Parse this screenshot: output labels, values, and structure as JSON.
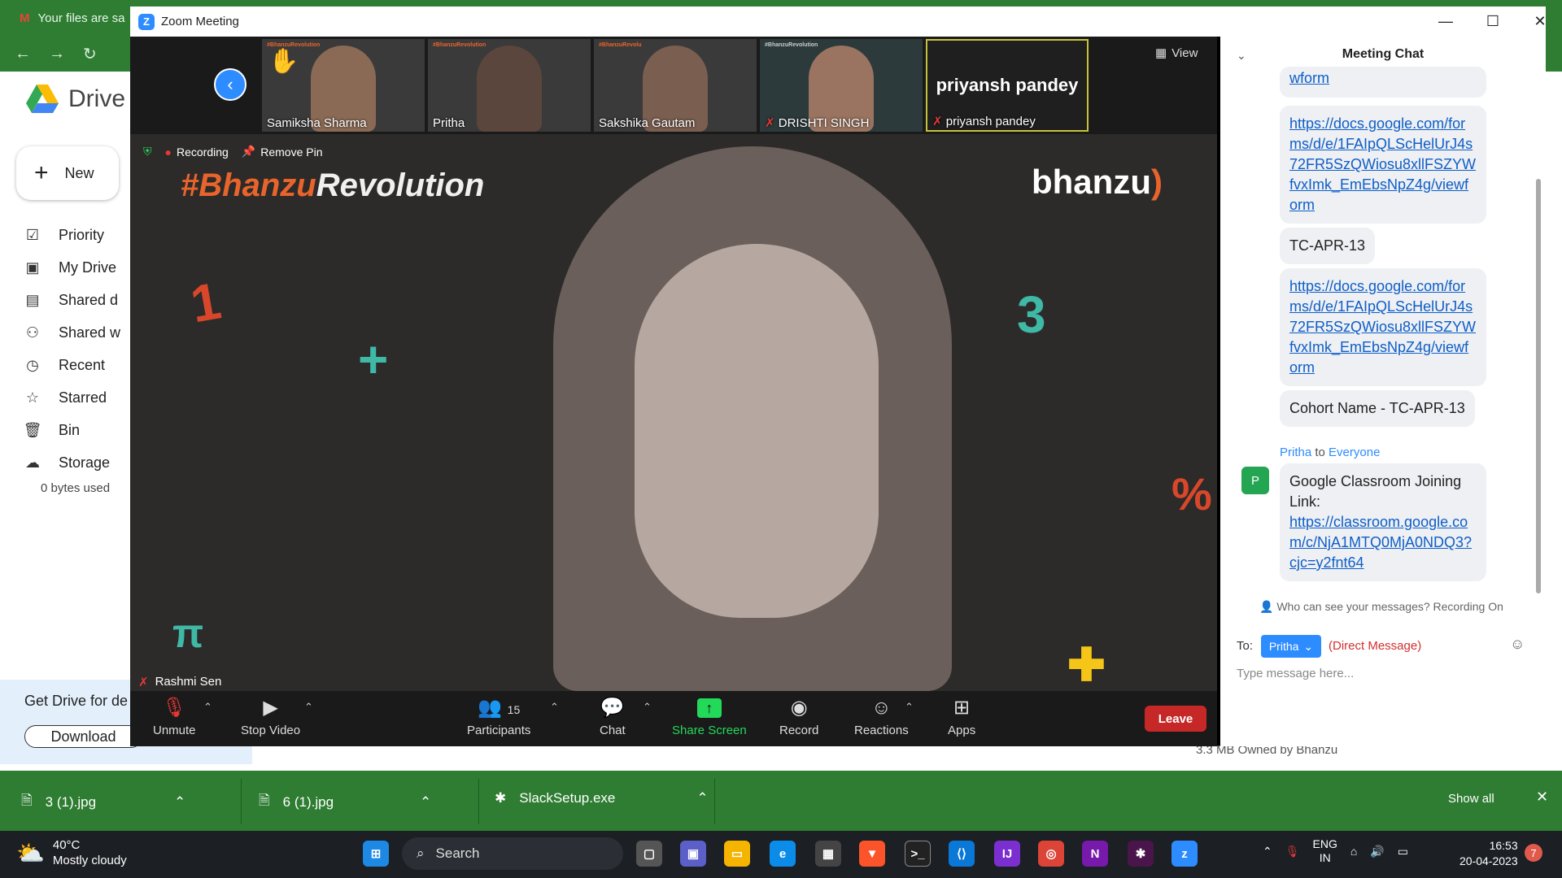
{
  "browser": {
    "tab_title": "Your files are sa"
  },
  "drive": {
    "title": "Drive",
    "new_label": "New",
    "nav": [
      {
        "label": "Priority",
        "icon": "priority-icon"
      },
      {
        "label": "My Drive",
        "icon": "my-drive-icon"
      },
      {
        "label": "Shared d",
        "icon": "shared-drives-icon"
      },
      {
        "label": "Shared w",
        "icon": "shared-with-me-icon"
      },
      {
        "label": "Recent",
        "icon": "clock-icon"
      },
      {
        "label": "Starred",
        "icon": "star-icon"
      },
      {
        "label": "Bin",
        "icon": "bin-icon"
      },
      {
        "label": "Storage",
        "icon": "cloud-icon"
      }
    ],
    "storage_used": "0 bytes used",
    "promo": "Get Drive for de",
    "download_label": "Download",
    "owned_text": "3.3 MB Owned by Bhanzu"
  },
  "zoom": {
    "window_title": "Zoom Meeting",
    "view_label": "View",
    "participants_strip": [
      {
        "name": "Samiksha Sharma",
        "hand": true
      },
      {
        "name": "Pritha",
        "hand": false
      },
      {
        "name": "Sakshika Gautam",
        "hand": false
      },
      {
        "name": "DRISHTI SINGH",
        "muted": true
      },
      {
        "name": "priyansh pandey",
        "muted": true,
        "video_off": true
      }
    ],
    "recording_label": "Recording",
    "remove_pin_label": "Remove Pin",
    "main_speaker": "Rashmi Sen",
    "background": {
      "hashtag_prefix": "#Bhanzu",
      "hashtag_suffix": "Revolution",
      "brand": "bhanzu"
    },
    "toolbar": {
      "unmute": "Unmute",
      "stop_video": "Stop Video",
      "participants": "Participants",
      "participants_count": "15",
      "chat": "Chat",
      "share_screen": "Share Screen",
      "record": "Record",
      "reactions": "Reactions",
      "apps": "Apps",
      "leave": "Leave"
    },
    "colors": {
      "accent": "#2d8cff",
      "share": "#23d959",
      "leave": "#c62828"
    }
  },
  "chat": {
    "title": "Meeting Chat",
    "messages": [
      {
        "text": "wform"
      },
      {
        "link": "https://docs.google.com/forms/d/e/1FAIpQLScHelUrJ4s72FR5SzQWiosu8xllFSZYWfvxImk_EmEbsNpZ4g/viewform"
      },
      {
        "text": "TC-APR-13"
      },
      {
        "link": "https://docs.google.com/forms/d/e/1FAIpQLScHelUrJ4s72FR5SzQWiosu8xllFSZYWfvxImk_EmEbsNpZ4g/viewform"
      },
      {
        "text": "Cohort Name - TC-APR-13"
      }
    ],
    "last_sender": "Pritha",
    "to_word": "to",
    "to_everyone": "Everyone",
    "avatar_letter": "P",
    "last_text": "Google Classroom Joining Link:",
    "last_link": "https://classroom.google.com/c/NjA1MTQ0MjA0NDQ3?cjc=y2fnt64",
    "privacy": "Who can see your messages? Recording On",
    "to_label": "To:",
    "recipient": "Pritha",
    "direct_message": "(Direct Message)",
    "placeholder": "Type message here..."
  },
  "downloads": {
    "items": [
      "3 (1).jpg",
      "6 (1).jpg",
      "SlackSetup.exe"
    ],
    "show_all": "Show all"
  },
  "taskbar": {
    "temperature": "40°C",
    "weather": "Mostly cloudy",
    "search": "Search",
    "lang1": "ENG",
    "lang2": "IN",
    "time": "16:53",
    "date": "20-04-2023",
    "notifications": "7"
  }
}
